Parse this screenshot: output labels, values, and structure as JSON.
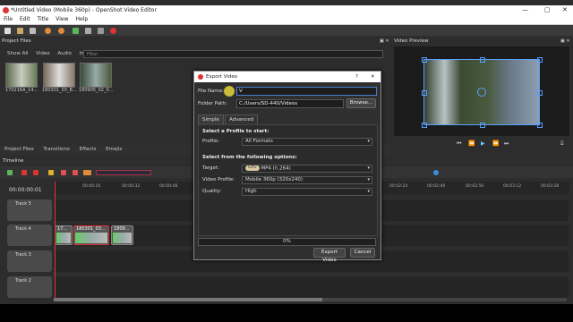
{
  "window": {
    "title": "*Untitled Video (Mobile 360p) - OpenShot Video Editor",
    "minimize": "—",
    "maximize": "▢",
    "close": "✕"
  },
  "menu": [
    "File",
    "Edit",
    "Title",
    "View",
    "Help"
  ],
  "project_files": {
    "header": "Project Files",
    "tabs": [
      "Show All",
      "Video",
      "Audio",
      "Image"
    ],
    "filter_placeholder": "Filter",
    "files": [
      "170216A_14...",
      "180301_03_B...",
      "180905_02_0..."
    ]
  },
  "video_preview": {
    "header": "Video Preview"
  },
  "lower_tabs": [
    "Project Files",
    "Transitions",
    "Effects",
    "Emojis"
  ],
  "timeline": {
    "header": "Timeline",
    "current_time": "00:00:00:01",
    "ruler_ticks": [
      "00:00:16",
      "00:00:32",
      "00:00:48",
      "00:02:24",
      "00:02:40",
      "00:02:56",
      "00:03:12",
      "00:03:28"
    ],
    "tracks": [
      "Track 5",
      "Track 4",
      "Track 3",
      "Track 2"
    ],
    "clips": [
      "17...",
      "180301_03...",
      "1809..."
    ]
  },
  "export_dialog": {
    "title": "Export Video",
    "help": "?",
    "close": "✕",
    "file_name_label": "File Name:",
    "file_name_value": "V",
    "folder_path_label": "Folder Path:",
    "folder_path_value": "C:/Users/SD-440/Videos",
    "browse_button": "Browse...",
    "tabs": [
      "Simple",
      "Advanced"
    ],
    "profile_section": "Select a Profile to start:",
    "profile_label": "Profile:",
    "profile_value": "All Formats",
    "options_section": "Select from the following options:",
    "target_label": "Target:",
    "target_badge": "GPU",
    "target_value": "MP4 (h.264)",
    "video_profile_label": "Video Profile:",
    "video_profile_value": "Mobile 360p (320x240)",
    "quality_label": "Quality:",
    "quality_value": "High",
    "progress_text": "0%",
    "progress_fraction": 0,
    "export_button": "Export Video",
    "cancel_button": "Cancel"
  },
  "colors": {
    "accent": "#4a7ed0",
    "playhead": "#e33333",
    "record": "#d33333"
  }
}
